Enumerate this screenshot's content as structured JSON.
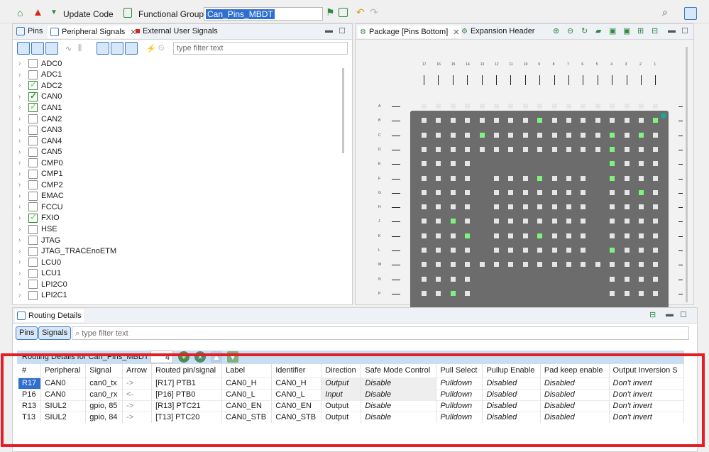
{
  "toolbar": {
    "update_code": "Update Code",
    "functional_group_label": "Functional Group",
    "functional_group_value": "Can_Pins_MBDT"
  },
  "left_panel": {
    "tabs": [
      "Pins",
      "Peripheral Signals",
      "External User Signals"
    ],
    "filter_placeholder": "type filter text",
    "tree": [
      {
        "label": "ADC0",
        "checked": "none"
      },
      {
        "label": "ADC1",
        "checked": "none"
      },
      {
        "label": "ADC2",
        "checked": "partial"
      },
      {
        "label": "CAN0",
        "checked": "full"
      },
      {
        "label": "CAN1",
        "checked": "partial"
      },
      {
        "label": "CAN2",
        "checked": "none"
      },
      {
        "label": "CAN3",
        "checked": "none"
      },
      {
        "label": "CAN4",
        "checked": "none"
      },
      {
        "label": "CAN5",
        "checked": "none"
      },
      {
        "label": "CMP0",
        "checked": "none"
      },
      {
        "label": "CMP1",
        "checked": "none"
      },
      {
        "label": "CMP2",
        "checked": "none"
      },
      {
        "label": "EMAC",
        "checked": "none"
      },
      {
        "label": "FCCU",
        "checked": "none"
      },
      {
        "label": "FXIO",
        "checked": "partial"
      },
      {
        "label": "HSE",
        "checked": "none"
      },
      {
        "label": "JTAG",
        "checked": "none"
      },
      {
        "label": "JTAG_TRACEnoETM",
        "checked": "none"
      },
      {
        "label": "LCU0",
        "checked": "none"
      },
      {
        "label": "LCU1",
        "checked": "none"
      },
      {
        "label": "LPI2C0",
        "checked": "none"
      },
      {
        "label": "LPI2C1",
        "checked": "none"
      }
    ]
  },
  "package_panel": {
    "tabs": [
      "Package [Pins Bottom]",
      "Expansion Header"
    ],
    "columns": [
      "17",
      "16",
      "15",
      "14",
      "13",
      "12",
      "11",
      "10",
      "9",
      "8",
      "7",
      "6",
      "5",
      "4",
      "3",
      "2",
      "1"
    ],
    "rows": [
      "A",
      "B",
      "C",
      "D",
      "E",
      "F",
      "G",
      "H",
      "J",
      "K",
      "L",
      "M",
      "N",
      "P"
    ],
    "highlighted_pins": [
      "B9",
      "B1",
      "C13",
      "C4",
      "C2",
      "D4",
      "E4",
      "F9",
      "F4",
      "G2",
      "J15",
      "K14",
      "K9",
      "L4",
      "P15",
      "P5"
    ]
  },
  "routing": {
    "tab": "Routing Details",
    "pins_button": "Pins",
    "signals_button": "Signals",
    "filter_placeholder": "type filter text",
    "title": "Routing Details for Can_Pins_MBDT",
    "count": "4",
    "columns": [
      "#",
      "Peripheral",
      "Signal",
      "Arrow",
      "Routed pin/signal",
      "Label",
      "Identifier",
      "Direction",
      "Safe Mode Control",
      "Pull Select",
      "Pullup Enable",
      "Pad keep enable",
      "Output Inversion S"
    ],
    "rows": [
      [
        "R17",
        "CAN0",
        "can0_tx",
        "->",
        "[R17] PTB1",
        "CAN0_H",
        "CAN0_H",
        "Output",
        "Disable",
        "Pulldown",
        "Disabled",
        "Disabled",
        "Don't invert"
      ],
      [
        "P16",
        "CAN0",
        "can0_rx",
        "<-",
        "[P16] PTB0",
        "CAN0_L",
        "CAN0_L",
        "Input",
        "Disable",
        "Pulldown",
        "Disabled",
        "Disabled",
        "Don't invert"
      ],
      [
        "R13",
        "SIUL2",
        "gpio, 85",
        "->",
        "[R13] PTC21",
        "CAN0_EN",
        "CAN0_EN",
        "Output",
        "Disable",
        "Pulldown",
        "Disabled",
        "Disabled",
        "Don't invert"
      ],
      [
        "T13",
        "SIUL2",
        "gpio, 84",
        "->",
        "[T13] PTC20",
        "CAN0_STB",
        "CAN0_STB",
        "Output",
        "Disable",
        "Pulldown",
        "Disabled",
        "Disabled",
        "Don't invert"
      ]
    ]
  },
  "colors": {
    "accent": "#2f6fce",
    "highlight": "#e41e25",
    "pin_active": "#7ef37e"
  }
}
